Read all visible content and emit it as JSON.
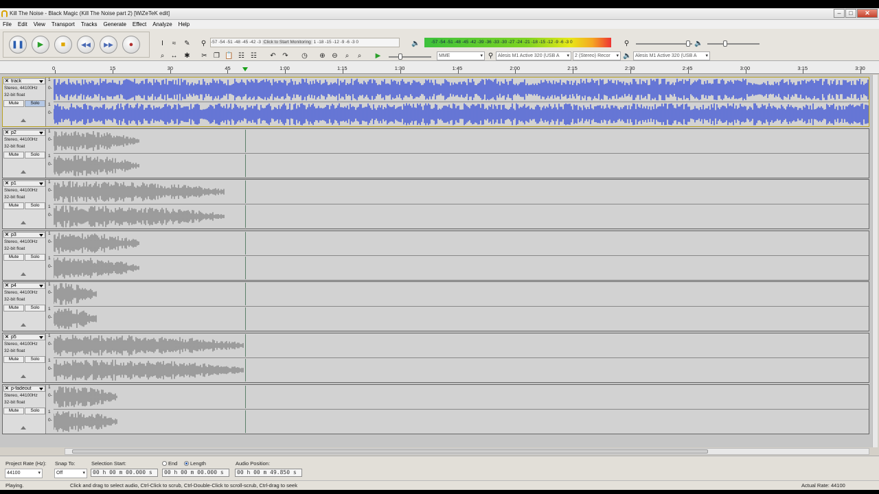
{
  "window": {
    "title": "Kill The Noise - Black Magic (Kill The Noise part 2) [WiZeTeK edit]",
    "buttons": [
      "–",
      "□",
      "✕"
    ]
  },
  "menu": [
    "File",
    "Edit",
    "View",
    "Transport",
    "Tracks",
    "Generate",
    "Effect",
    "Analyze",
    "Help"
  ],
  "meters": {
    "record_scale": "-57 -54 -51 -48 -45 -42 -3",
    "record_hint": "Click to Start Monitoring",
    "record_scale_right": "1 -18 -15 -12 -9 -6 -3 0",
    "record_channels": "L\nR",
    "playback_scale": "-57 -54 -51 -48 -45 -42 -39 -36 -33 -30 -27 -24 -21 -18 -15 -12 -9 -6 -3 0"
  },
  "devices": {
    "host": "MME",
    "recording_device": "Alesis M1 Active 320 (USB A",
    "channels": "2 (Stereo) Recor",
    "playback_device": "Alesis M1 Active 320 (USB A"
  },
  "ruler": [
    "0",
    "15",
    "30",
    "45",
    "1:00",
    "1:15",
    "1:30",
    "1:45",
    "2:00",
    "2:15",
    "2:30",
    "2:45",
    "3:00",
    "3:15",
    "3:30"
  ],
  "tracks": [
    {
      "name": "track",
      "info1": "Stereo, 44100Hz",
      "info2": "32-bit float",
      "mute": "Mute",
      "solo": "Solo",
      "selected": true,
      "clip_end": 1.0,
      "color": "#4a5fd6"
    },
    {
      "name": "p2",
      "info1": "Stereo, 44100Hz",
      "info2": "32-bit float",
      "mute": "Mute",
      "solo": "Solo",
      "selected": false,
      "clip_end": 0.105,
      "color": "#8e8e8e"
    },
    {
      "name": "p1",
      "info1": "Stereo, 44100Hz",
      "info2": "32-bit float",
      "mute": "Mute",
      "solo": "Solo",
      "selected": false,
      "clip_end": 0.21,
      "color": "#8e8e8e"
    },
    {
      "name": "p3",
      "info1": "Stereo, 44100Hz",
      "info2": "32-bit float",
      "mute": "Mute",
      "solo": "Solo",
      "selected": false,
      "clip_end": 0.105,
      "color": "#8e8e8e"
    },
    {
      "name": "p4",
      "info1": "Stereo, 44100Hz",
      "info2": "32-bit float",
      "mute": "Mute",
      "solo": "Solo",
      "selected": false,
      "clip_end": 0.054,
      "color": "#8e8e8e"
    },
    {
      "name": "p5",
      "info1": "Stereo, 44100Hz",
      "info2": "32-bit float",
      "mute": "Mute",
      "solo": "Solo",
      "selected": false,
      "clip_end": 0.233,
      "color": "#8e8e8e"
    },
    {
      "name": "p-fadeout",
      "info1": "Stereo, 44100Hz",
      "info2": "32-bit float",
      "mute": "Mute",
      "solo": "Solo",
      "selected": false,
      "clip_end": 0.078,
      "color": "#8e8e8e"
    }
  ],
  "scale_labels": {
    "top": "1",
    "mid": "0-"
  },
  "selection": {
    "project_rate_label": "Project Rate (Hz):",
    "project_rate": "44100",
    "snap_to_label": "Snap To:",
    "snap_to": "Off",
    "selection_start_label": "Selection Start:",
    "end_label": "End",
    "length_label": "Length",
    "selection_start": "00 h 00 m 00.000 s",
    "length": "00 h 00 m 00.000 s",
    "audio_position_label": "Audio Position:",
    "audio_position": "00 h 00 m 49.850 s"
  },
  "status": {
    "state": "Playing.",
    "hint": "Click and drag to select audio, Ctrl-Click to scrub, Ctrl-Double-Click to scroll-scrub, Ctrl-drag to seek",
    "actual_rate": "Actual Rate: 44100"
  }
}
